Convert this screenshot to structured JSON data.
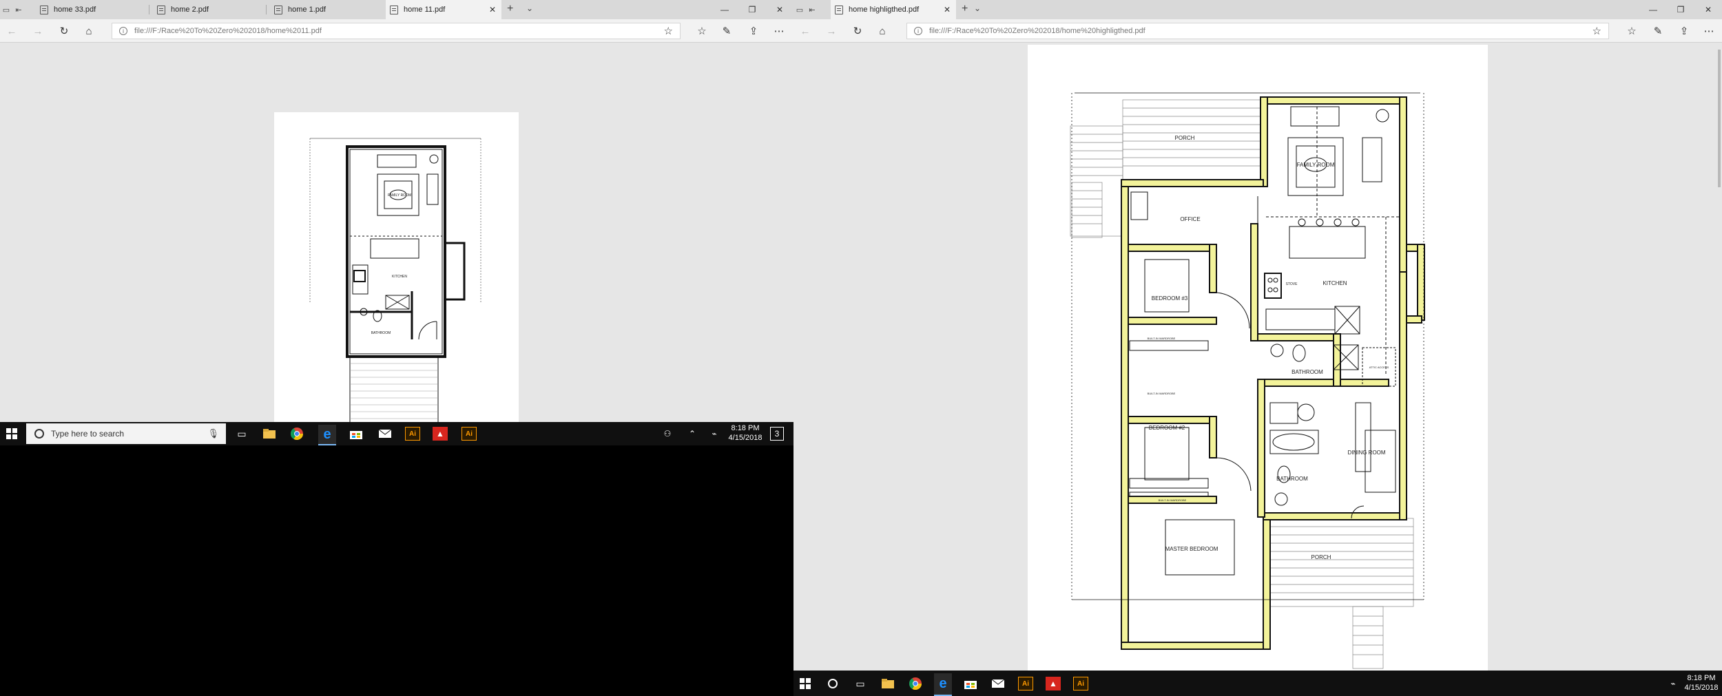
{
  "left_window": {
    "tabs": [
      {
        "label": "home 33.pdf",
        "active": false
      },
      {
        "label": "home 2.pdf",
        "active": false
      },
      {
        "label": "home 1.pdf",
        "active": false
      },
      {
        "label": "home 11.pdf",
        "active": true
      }
    ],
    "address": "file:///F:/Race%20To%20Zero%202018/home%2011.pdf",
    "plan_labels": {
      "family_room": "FAMILY ROOM",
      "kitchen": "KITCHEN",
      "bathroom": "BATHROOM"
    }
  },
  "right_window": {
    "tabs": [
      {
        "label": "home highligthed.pdf",
        "active": true
      }
    ],
    "address": "file:///F:/Race%20To%20Zero%202018/home%20highligthed.pdf",
    "plan_labels": {
      "porch_top": "PORCH",
      "family_room": "FAMILY ROOM",
      "office": "OFFICE",
      "kitchen": "KITCHEN",
      "stove": "STOVE",
      "bedroom3": "BEDROOM #3",
      "bathroom1": "BATHROOM",
      "bedroom2": "BEDROOM #2",
      "dining_room": "DINING ROOM",
      "bathroom2": "BATHROOM",
      "master_bedroom": "MASTER BEDROOM",
      "porch_bottom": "PORCH",
      "wardrobe1": "BUILT-IN WARDROBE",
      "wardrobe2": "BUILT-IN WARDROBE",
      "wardrobe3": "BUILT-IN WARDROBE",
      "attic_access": "ATTIC ACCESS"
    }
  },
  "taskbar_left": {
    "search_placeholder": "Type here to search",
    "time": "8:18 PM",
    "date": "4/15/2018"
  },
  "taskbar_right": {
    "time": "8:18 PM",
    "date": "4/15/2018"
  },
  "colors": {
    "highlight": "#f3f39a",
    "wall": "#111111",
    "edge_blue": "#1e90ff",
    "ai_orange": "#ff9a00",
    "acrobat_red": "#d7261e"
  }
}
